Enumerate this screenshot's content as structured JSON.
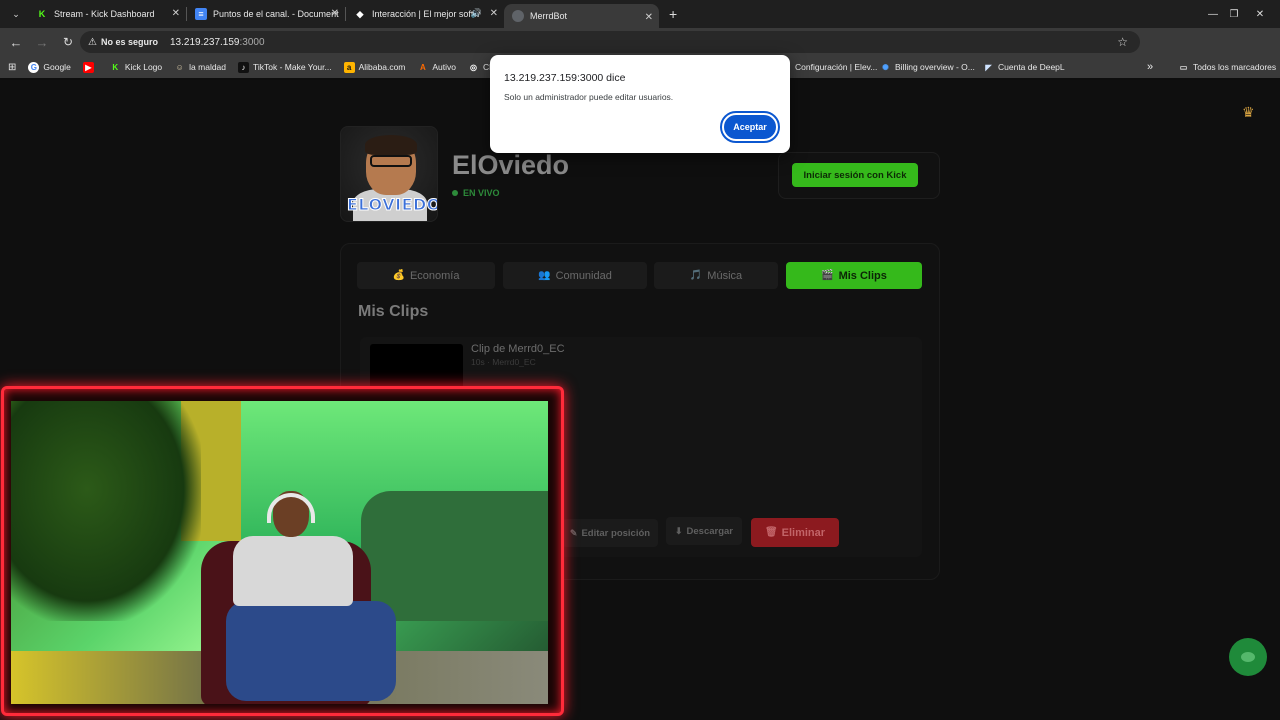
{
  "browser": {
    "tabs": [
      {
        "label": "Stream - Kick Dashboard",
        "icon": "kick-icon",
        "color": "#53fc18"
      },
      {
        "label": "Puntos de el canal. - Document",
        "icon": "docs-icon",
        "color": "#4285f4"
      },
      {
        "label": "Interacción | El mejor softw",
        "icon": "diamond-icon",
        "color": "#ffffff"
      },
      {
        "label": "MerrdBot",
        "icon": "globe-icon",
        "color": "#9aa0a6"
      }
    ],
    "new_tab": "+",
    "window_controls": {
      "minimize": "—",
      "restore": "❐",
      "close": "✕"
    },
    "address": {
      "warning": "No es seguro",
      "host": "13.219.237.159",
      "port": ":3000"
    },
    "bookmarks": [
      {
        "label": "Google",
        "icon": "G",
        "color": "#ffffff"
      },
      {
        "label": "",
        "icon": "▶",
        "color": "#ff0000"
      },
      {
        "label": "Kick Logo",
        "icon": "K",
        "color": "#53fc18"
      },
      {
        "label": "la maldad",
        "icon": "☺",
        "color": "#d7c9a8"
      },
      {
        "label": "TikTok - Make Your...",
        "icon": "♪",
        "color": "#111111"
      },
      {
        "label": "Alibaba.com",
        "icon": "a",
        "color": "#ff6a00"
      },
      {
        "label": "Autivo",
        "icon": "A",
        "color": "#ff6a00"
      },
      {
        "label": "Chat G",
        "icon": "◎",
        "color": "#ffffff"
      },
      {
        "label": "Configuración | Elev...",
        "icon": "⚙",
        "color": "#9aa0a6"
      },
      {
        "label": "Billing overview - O...",
        "icon": "✺",
        "color": "#4ea0ff"
      },
      {
        "label": "Cuenta de DeepL",
        "icon": "◤",
        "color": "#0f2b46"
      }
    ],
    "bookmarks_more": "»",
    "all_bookmarks": "Todos los marcadores"
  },
  "dialog": {
    "title": "13.219.237.159:3000 dice",
    "message": "Solo un administrador puede editar usuarios.",
    "accept_label": "Aceptar"
  },
  "profile": {
    "avatar_text": "ELOVIEDO",
    "name": "ElOviedo",
    "status": "EN VIVO",
    "login_label": "Iniciar sesión con Kick"
  },
  "tabs": [
    {
      "icon": "💰",
      "label": "Economía"
    },
    {
      "icon": "👥",
      "label": "Comunidad"
    },
    {
      "icon": "🎵",
      "label": "Música"
    },
    {
      "icon": "🎬",
      "label": "Mis Clips"
    }
  ],
  "clips": {
    "section_title": "Mis Clips",
    "items": [
      {
        "title": "Clip de Merrd0_EC",
        "meta": "10s · Merrd0_EC"
      }
    ],
    "actions": {
      "edit_icon": "✎",
      "edit_label": "Editar posición",
      "download_icon": "⬇",
      "download_label": "Descargar",
      "delete_icon": "🗑",
      "delete_label": "Eliminar"
    }
  },
  "colors": {
    "accent_green": "#35b91b",
    "danger_red": "#8c1a1f",
    "webcam_border": "#ff2b3a",
    "dialog_button": "#0b57d0"
  }
}
